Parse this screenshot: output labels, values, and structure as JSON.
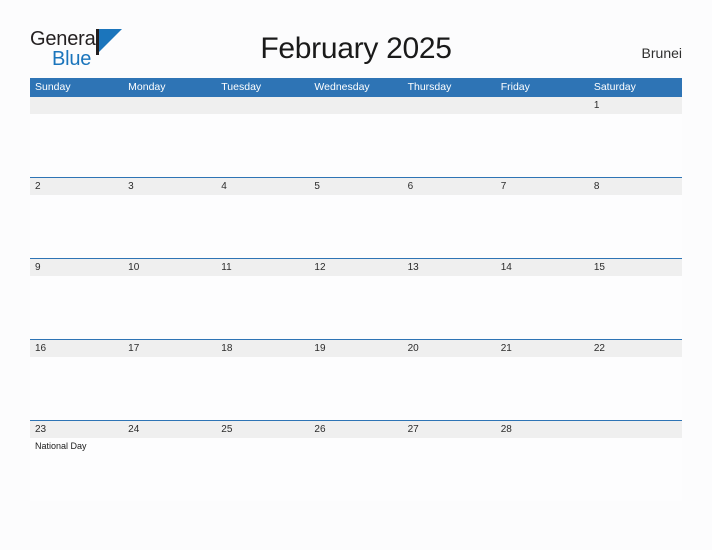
{
  "brand": {
    "name_top": "General",
    "name_bottom": "Blue",
    "flag_icon": "flag-triangle-icon",
    "accent_color": "#1b75bc"
  },
  "header": {
    "title": "February 2025",
    "country": "Brunei"
  },
  "theme": {
    "header_bar_color": "#2e74b5",
    "date_band_color": "#efefef",
    "page_background": "#fcfcfd",
    "text_color": "#2b2b2b"
  },
  "calendar": {
    "month": "February",
    "year": "2025",
    "day_names": [
      "Sunday",
      "Monday",
      "Tuesday",
      "Wednesday",
      "Thursday",
      "Friday",
      "Saturday"
    ],
    "weeks": [
      {
        "dates": [
          "",
          "",
          "",
          "",
          "",
          "",
          "1"
        ],
        "events": [
          "",
          "",
          "",
          "",
          "",
          "",
          ""
        ]
      },
      {
        "dates": [
          "2",
          "3",
          "4",
          "5",
          "6",
          "7",
          "8"
        ],
        "events": [
          "",
          "",
          "",
          "",
          "",
          "",
          ""
        ]
      },
      {
        "dates": [
          "9",
          "10",
          "11",
          "12",
          "13",
          "14",
          "15"
        ],
        "events": [
          "",
          "",
          "",
          "",
          "",
          "",
          ""
        ]
      },
      {
        "dates": [
          "16",
          "17",
          "18",
          "19",
          "20",
          "21",
          "22"
        ],
        "events": [
          "",
          "",
          "",
          "",
          "",
          "",
          ""
        ]
      },
      {
        "dates": [
          "23",
          "24",
          "25",
          "26",
          "27",
          "28",
          ""
        ],
        "events": [
          "National Day",
          "",
          "",
          "",
          "",
          "",
          ""
        ]
      }
    ]
  }
}
